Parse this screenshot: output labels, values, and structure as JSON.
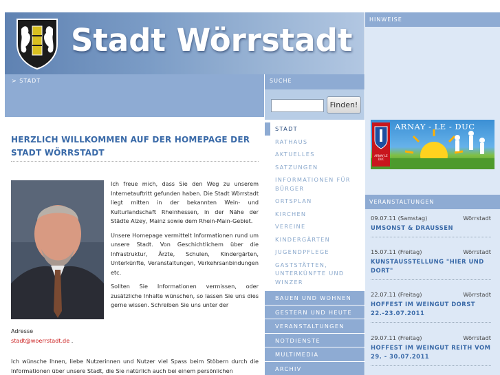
{
  "header": {
    "title": "Stadt Wörrstadt"
  },
  "breadcrumb": {
    "text": "> STADT"
  },
  "search": {
    "heading": "SUCHE",
    "placeholder": "",
    "button_label": "Finden!"
  },
  "main": {
    "title": "HERZLICH WILLKOMMEN AUF DER HOMEPAGE DER STADT WÖRRSTADT",
    "paragraphs": [
      "Ich freue mich, dass Sie den Weg zu unserem Internetauftritt gefunden haben. Die Stadt Wörrstadt liegt mitten in der bekannten Wein- und Kulturlandschaft Rheinhessen, in der Nähe der Städte Alzey, Mainz sowie dem Rhein-Main-Gebiet.",
      "Unsere Homepage vermittelt Informationen rund um unsere Stadt. Von Geschichtlichem über die Infrastruktur, Ärzte, Schulen, Kindergärten, Unterkünfte, Veranstaltungen, Verkehrsanbindungen etc.",
      "Sollten Sie Informationen vermissen, oder zusätzliche Inhalte wünschen, so lassen Sie uns dies gerne wissen. Schreiben Sie uns unter der"
    ],
    "address_label": "Adresse",
    "email": "stadt@woerrstadt.de",
    "email_suffix": " .",
    "closing": "Ich wünsche Ihnen, liebe Nutzerinnen und Nutzer viel Spass beim Stöbern durch die Informationen über unsere Stadt, die Sie natürlich auch bei einem persönlichen"
  },
  "nav": {
    "sub_items": [
      {
        "label": "STADT",
        "active": true
      },
      {
        "label": "RATHAUS"
      },
      {
        "label": "AKTUELLES"
      },
      {
        "label": "SATZUNGEN"
      },
      {
        "label": "INFORMATIONEN FÜR BÜRGER"
      },
      {
        "label": "ORTSPLAN"
      },
      {
        "label": "KIRCHEN"
      },
      {
        "label": "VEREINE"
      },
      {
        "label": "KINDERGÄRTEN"
      },
      {
        "label": "JUGENDPFLEGE"
      },
      {
        "label": "GASTSTÄTTEN, UNTERKÜNFTE UND WINZER"
      }
    ],
    "main_items": [
      {
        "label": "BAUEN UND WOHNEN"
      },
      {
        "label": "GESTERN UND HEUTE"
      },
      {
        "label": "VERANSTALTUNGEN"
      },
      {
        "label": "NOTDIENSTE"
      },
      {
        "label": "MULTIMEDIA"
      },
      {
        "label": "ARCHIV"
      }
    ]
  },
  "hinweise": {
    "heading": "HINWEISE",
    "banner_text": "ARNAY - LE - DUC",
    "banner_badge": "ARNAY LE DUC"
  },
  "events": {
    "heading": "VERANSTALTUNGEN",
    "items": [
      {
        "date": "09.07.11 (Samstag)",
        "place": "Wörrstadt",
        "title": "UMSONST & DRAUSSEN"
      },
      {
        "date": "15.07.11 (Freitag)",
        "place": "Wörrstadt",
        "title": "KUNSTAUSSTELLUNG \"HIER UND DORT\""
      },
      {
        "date": "22.07.11 (Freitag)",
        "place": "Wörrstadt",
        "title": "HOFFEST IM WEINGUT DORST 22.-23.07.2011"
      },
      {
        "date": "29.07.11 (Freitag)",
        "place": "Wörrstadt",
        "title": "HOFFEST IM WEINGUT REITH VOM 29. - 30.07.2011"
      }
    ]
  },
  "colors": {
    "accent_blue": "#8eabd3",
    "title_blue": "#3a6aa8",
    "light_panel": "#dde8f6",
    "link_red": "#cc2222"
  }
}
